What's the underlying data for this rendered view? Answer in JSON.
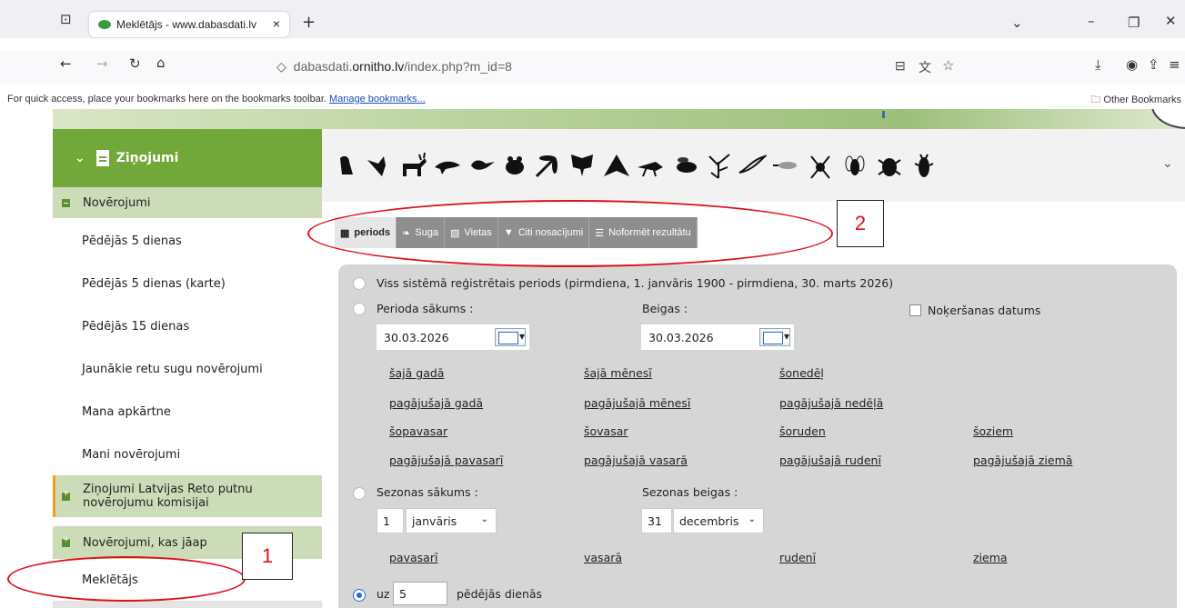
{
  "browser": {
    "tab_title": "Meklētājs - www.dabasdati.lv",
    "tab_close": "×",
    "new_tab": "+",
    "url_prefix": "dabasdati.",
    "url_domain": "ornitho.lv",
    "url_path": "/index.php?m_id=8",
    "bookmarks_text": "For quick access, place your bookmarks here on the bookmarks toolbar.",
    "manage_bookmarks": "Manage bookmarks...",
    "other_bookmarks": "Other Bookmarks"
  },
  "sidebar": {
    "header": "Ziņojumi",
    "group_1": "Novērojumi",
    "items": [
      "Pēdējās 5 dienas",
      "Pēdējās 5 dienas (karte)",
      "Pēdējās 15 dienas",
      "Jaunākie retu sugu novērojumi",
      "Mana apkārtne",
      "Mani novērojumi"
    ],
    "group_2_line1": "Ziņojumi Latvijas Reto putnu",
    "group_2_line2": "novērojumu komisijai",
    "group_3": "Novērojumi, kas jāap",
    "last_item": "Meklētājs"
  },
  "filter_tabs": {
    "periods": "periods",
    "suga": "Suga",
    "vietas": "Vietas",
    "citi": "Citi nosacījumi",
    "noformet": "Noformēt rezultātu"
  },
  "period_panel": {
    "all_period": "Viss sistēmā reģistrētais periods (pirmdiena, 1. janvāris 1900 - pirmdiena, 30. marts 2026)",
    "start_label": "Perioda sākums :",
    "end_label": "Beigas :",
    "catch_date": "Noķeršanas datums",
    "start_date": "30.03.2026",
    "end_date": "30.03.2026",
    "links_row1": [
      "šajā gadā",
      "šajā mēnesī",
      "šonedēļ"
    ],
    "links_row2": [
      "pagājušajā gadā",
      "pagājušajā mēnesī",
      "pagājušajā nedēļā"
    ],
    "links_row3": [
      "šopavasar",
      "šovasar",
      "šoruden",
      "šoziem"
    ],
    "links_row4": [
      "pagājušajā pavasarī",
      "pagājušajā vasarā",
      "pagājušajā rudenī",
      "pagājušajā ziemā"
    ],
    "season_start_label": "Sezonas sākums :",
    "season_end_label": "Sezonas beigas :",
    "season_start_day": "1",
    "season_start_month": "janvāris",
    "season_end_day": "31",
    "season_end_month": "decembris",
    "season_links": [
      "pavasarī",
      "vasarā",
      "rudenī",
      "ziema"
    ],
    "last_days_prefix": "uz",
    "last_days_value": "5",
    "last_days_suffix": "pēdējās dienās"
  },
  "annotations": {
    "marker_1": "1",
    "marker_2": "2",
    "annotation_color": "#e0101a"
  }
}
